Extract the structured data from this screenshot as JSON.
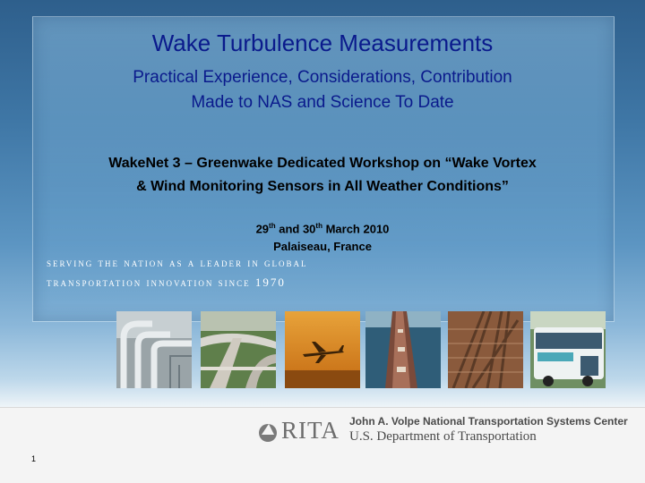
{
  "slide": {
    "title": "Wake Turbulence Measurements",
    "subtitle_line1": "Practical Experience, Considerations, Contribution",
    "subtitle_line2": "Made to NAS and Science To Date",
    "workshop_line1": "WakeNet 3 – Greenwake Dedicated Workshop on “Wake Vortex",
    "workshop_line2": "& Wind Monitoring Sensors in All Weather Conditions”",
    "date_day1": "29",
    "date_sup1": "th",
    "date_and": " and 30",
    "date_sup2": "th",
    "date_month": " March 2010",
    "location": "Palaiseau, France",
    "motto_line1": "Serving the Nation as a leader in global",
    "motto_line2": "transportation innovation since 1970"
  },
  "footer": {
    "logo_text": "RITA",
    "center_name": "John A. Volpe National Transportation Systems Center",
    "department": "U.S. Department of Transportation",
    "page_number": "1"
  },
  "photos": [
    {
      "name": "pipelines-photo"
    },
    {
      "name": "highway-interchange-photo"
    },
    {
      "name": "airplane-sunset-photo"
    },
    {
      "name": "ship-deck-photo"
    },
    {
      "name": "railroad-tracks-photo"
    },
    {
      "name": "bus-photo"
    }
  ],
  "colors": {
    "title": "#0a1a8c",
    "background_top": "#2e5f8c",
    "footer_text": "#4a4a4a"
  }
}
